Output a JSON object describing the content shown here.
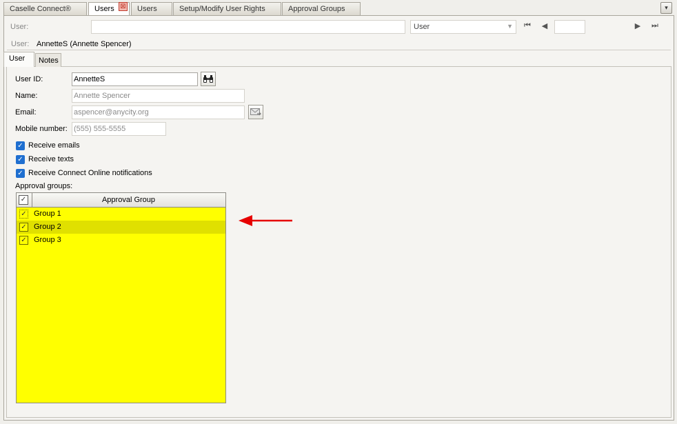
{
  "doc_tabs": [
    {
      "label": "Caselle Connect®"
    },
    {
      "label": "Users",
      "close": "⊠"
    },
    {
      "label": "Users"
    },
    {
      "label": "Setup/Modify User Rights"
    },
    {
      "label": "Approval Groups"
    }
  ],
  "menu_glyph": "▾",
  "toolbar": {
    "user_label": "User:",
    "search_value": "",
    "select_value": "User",
    "record_value": ""
  },
  "user_line": {
    "label": "User:",
    "value": "AnnetteS (Annette Spencer)"
  },
  "sub_tabs": [
    {
      "label": "User"
    },
    {
      "label": "Notes"
    }
  ],
  "form": {
    "user_id_label": "User ID:",
    "user_id_value": "AnnetteS",
    "name_label": "Name:",
    "name_value": "Annette Spencer",
    "email_label": "Email:",
    "email_value": "aspencer@anycity.org",
    "mobile_label": "Mobile number:",
    "mobile_value": "(555) 555-5555"
  },
  "checkboxes": [
    {
      "label": "Receive emails",
      "checked": true
    },
    {
      "label": "Receive texts",
      "checked": true
    },
    {
      "label": "Receive Connect Online notifications",
      "checked": true
    }
  ],
  "approval": {
    "label": "Approval groups:",
    "column_header": "Approval Group",
    "rows": [
      {
        "label": "Group 1",
        "checked": true
      },
      {
        "label": "Group 2",
        "checked": true
      },
      {
        "label": "Group 3",
        "checked": true
      }
    ]
  },
  "colors": {
    "grid_bg": "#ffff00",
    "grid_selected_row": "#e0e000",
    "checkbox_blue": "#1f6fd0",
    "annotation_arrow": "#e60000"
  }
}
